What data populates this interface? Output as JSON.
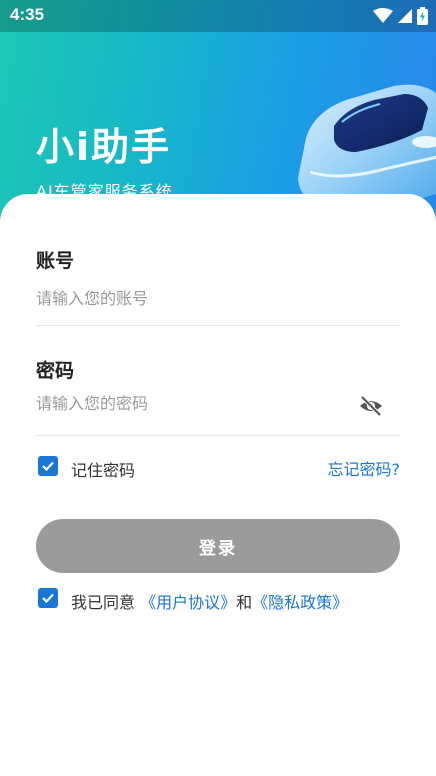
{
  "status_bar": {
    "time": "4:35"
  },
  "header": {
    "title": "小i助手",
    "subtitle": "AI车管家服务系统",
    "illustration": "car-illustration"
  },
  "login_form": {
    "account": {
      "label": "账号",
      "placeholder": "请输入您的账号",
      "value": ""
    },
    "password": {
      "label": "密码",
      "placeholder": "请输入您的密码",
      "value": "",
      "toggle_icon": "eye-off-icon"
    },
    "remember": {
      "label": "记住密码",
      "checked": true
    },
    "forgot_link": "忘记密码?",
    "login_button": "登录",
    "agreement": {
      "checked": true,
      "prefix": "我已同意",
      "user_agreement": "《用户协议》",
      "conjunction": "和",
      "privacy_policy": "《隐私政策》"
    }
  },
  "colors": {
    "accent": "#1976d2",
    "button_disabled": "#9b9b9b",
    "hero_start": "#1ec8b4",
    "hero_end": "#2a86ea"
  }
}
